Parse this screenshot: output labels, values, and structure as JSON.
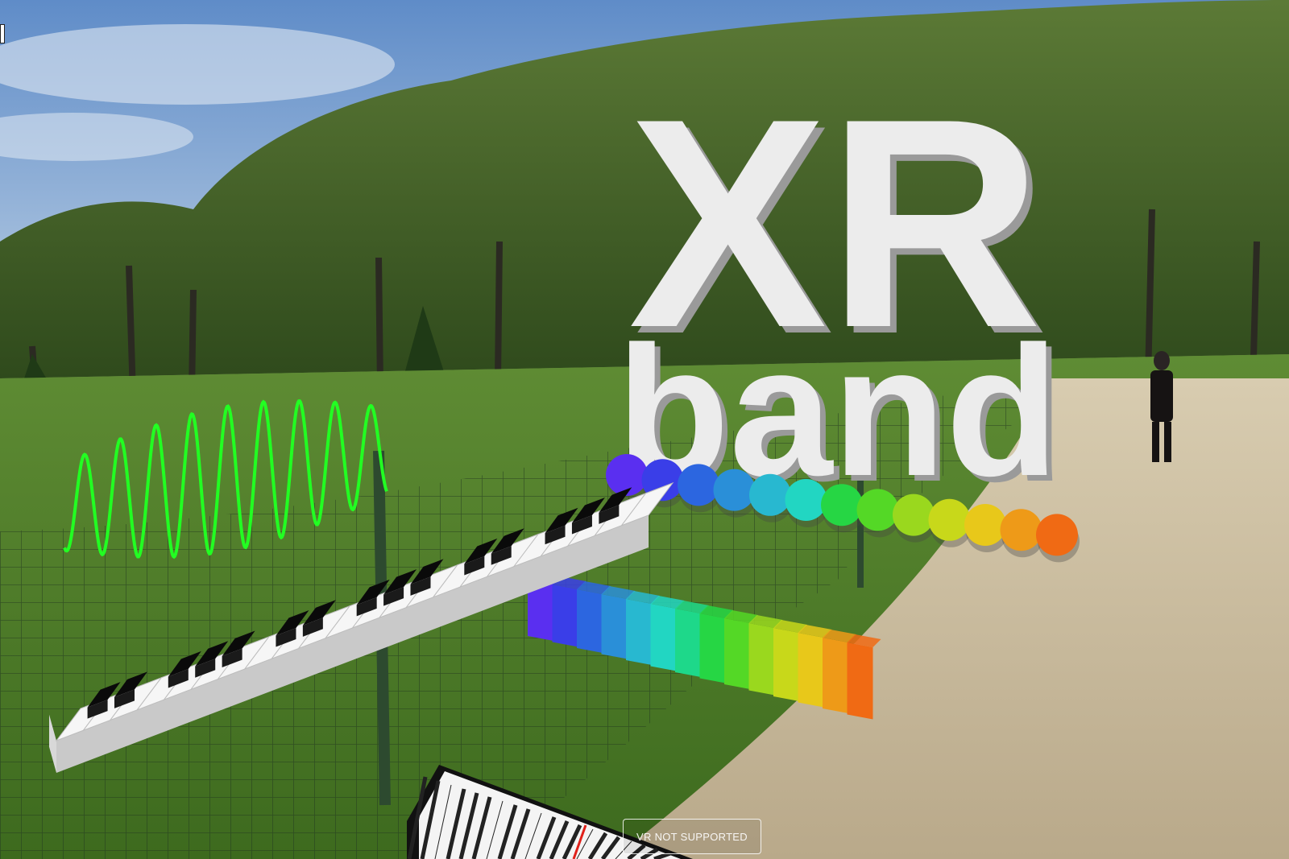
{
  "scene": {
    "title_line1": "XR",
    "title_line2": "band"
  },
  "vr_button": {
    "label": "VR NOT SUPPORTED"
  },
  "instruments": {
    "piano_keyboard": {
      "white_keys": 22
    },
    "color_bars": {
      "count": 14
    },
    "color_pads": {
      "count": 13
    },
    "waveform": {
      "cycles": 9
    }
  },
  "colors": {
    "sky": "#7fa8d6",
    "grass": "#4d7a2a",
    "path": "#c8b89a",
    "waveform": "#22ff22",
    "title": "#e9e9e9",
    "rainbow": [
      "#5a2ff0",
      "#3a3ee8",
      "#2c66e0",
      "#2a8fd8",
      "#28b8d0",
      "#22d6c2",
      "#1ed88a",
      "#26d644",
      "#54d826",
      "#9ad81e",
      "#c8d81a",
      "#e8c81a",
      "#ee9a18",
      "#f06a14"
    ]
  }
}
